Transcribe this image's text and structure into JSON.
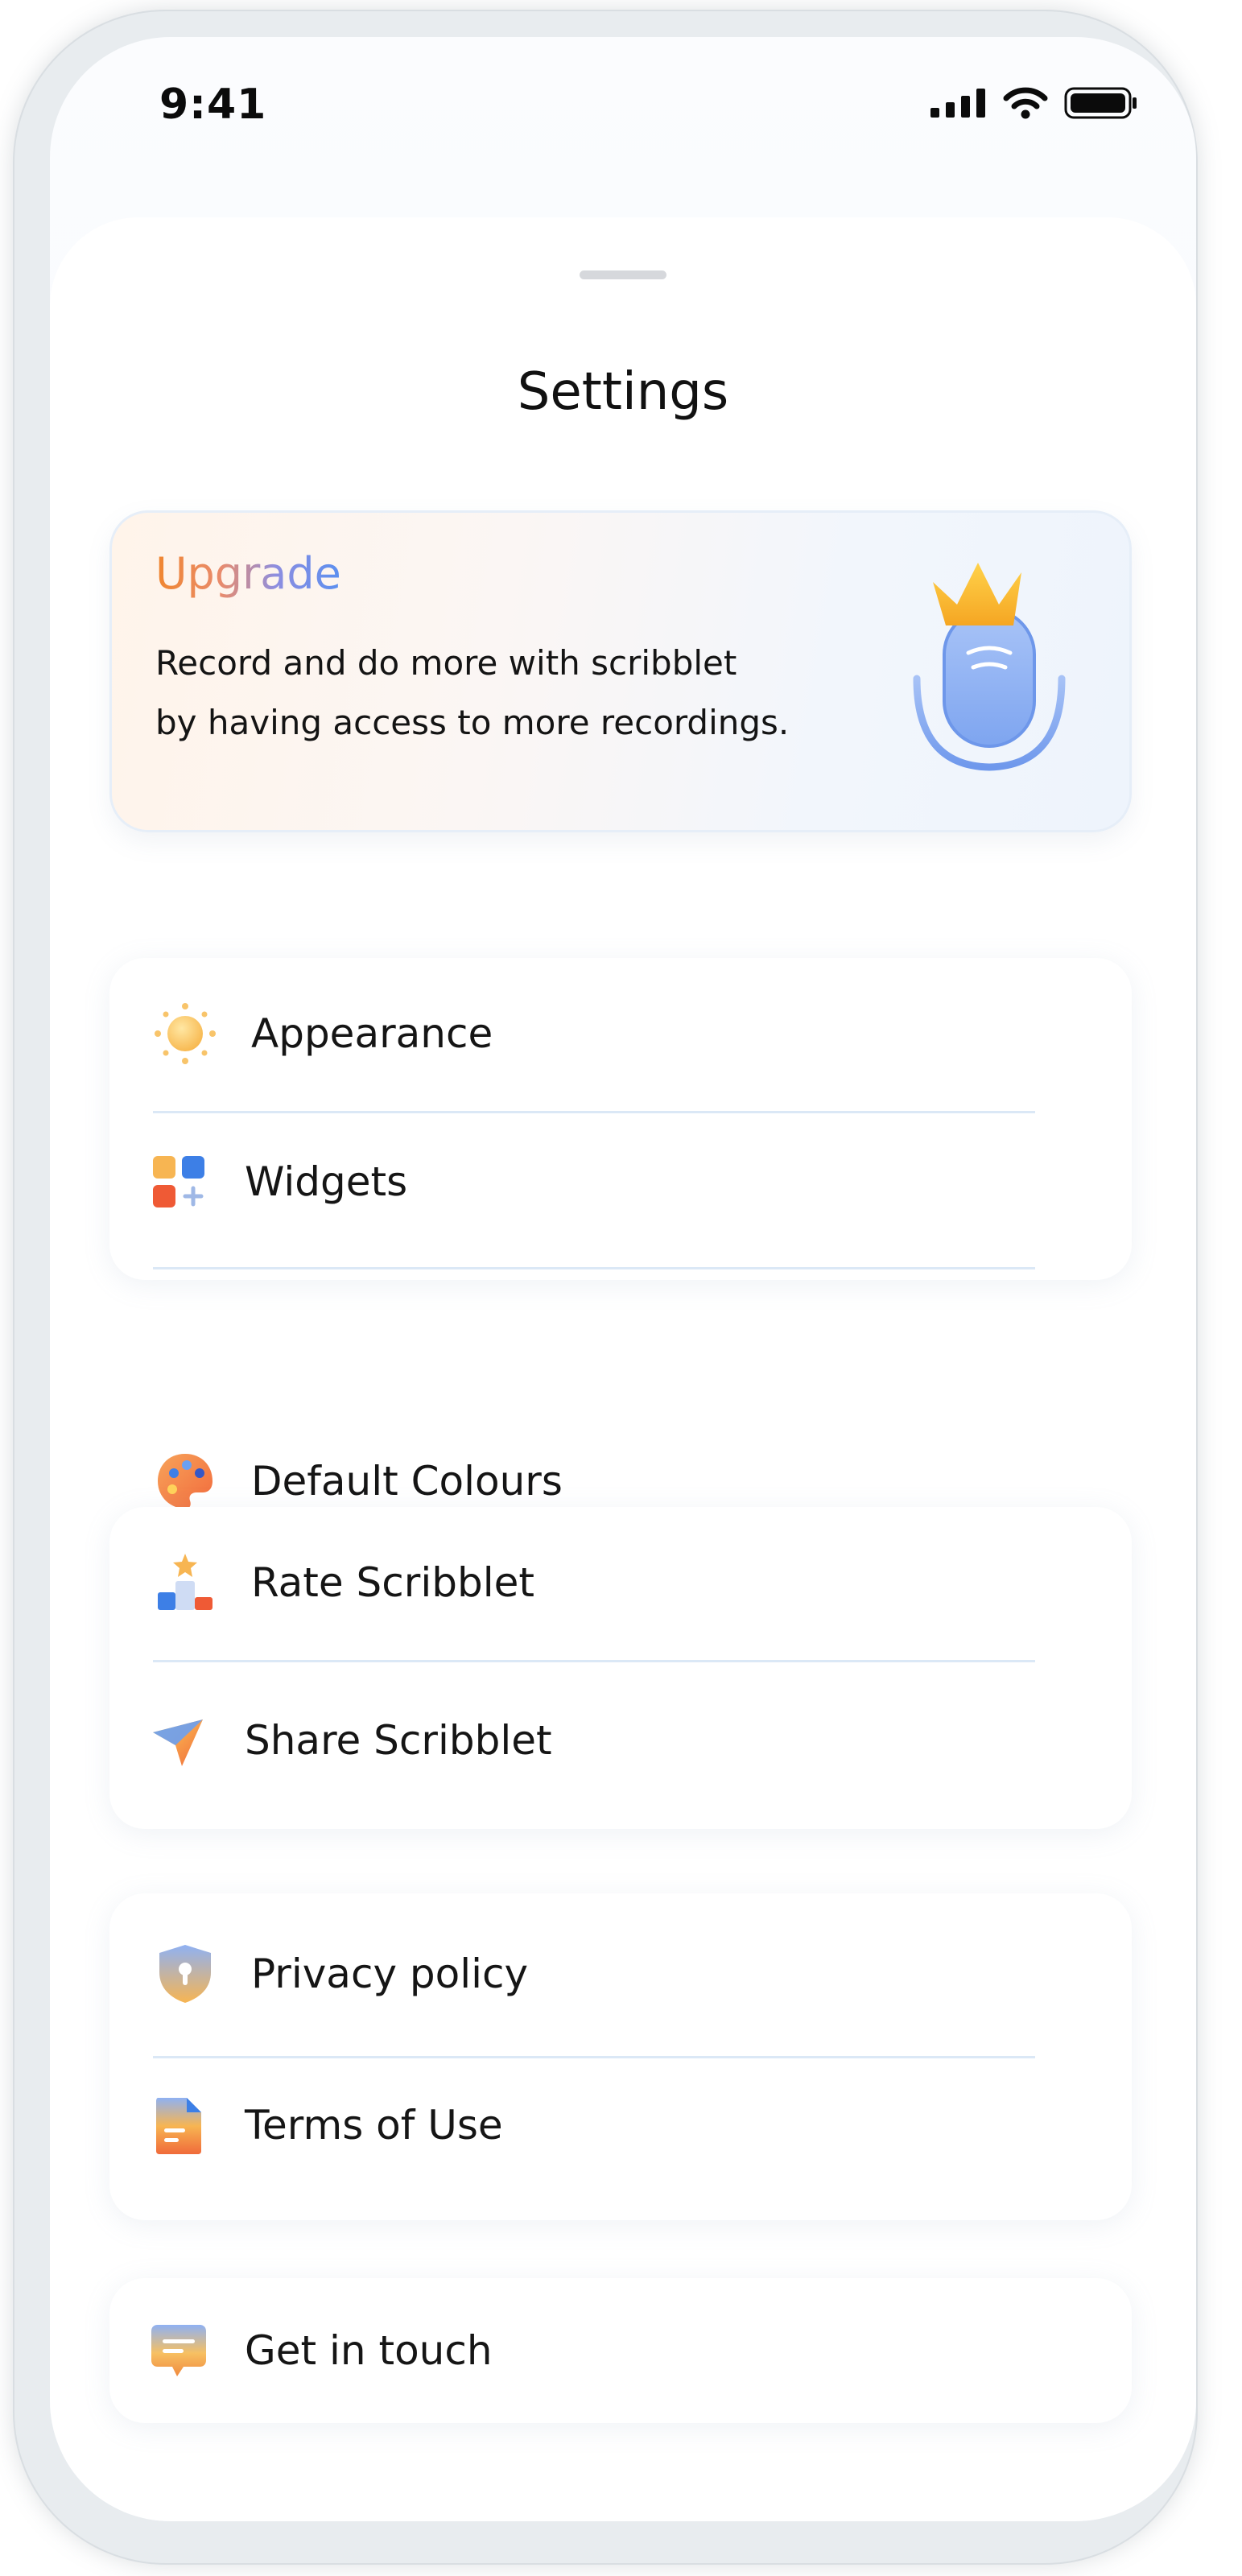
{
  "status_bar": {
    "time": "9:41",
    "icons": [
      "signal-icon",
      "wifi-icon",
      "battery-icon"
    ]
  },
  "sheet": {
    "title": "Settings"
  },
  "upgrade": {
    "title": "Upgrade",
    "line1": "Record and do more with scribblet",
    "line2": "by having access to more recordings.",
    "illustration": "crowned-mic-icon"
  },
  "groups": [
    {
      "items": [
        {
          "label": "Appearance",
          "icon": "sun-icon"
        },
        {
          "label": "Widgets",
          "icon": "widgets-icon"
        },
        {
          "label": "Default Colours",
          "icon": "palette-icon"
        }
      ]
    },
    {
      "items": [
        {
          "label": "Rate Scribblet",
          "icon": "podium-star-icon"
        },
        {
          "label": "Share Scribblet",
          "icon": "paper-plane-icon"
        }
      ]
    },
    {
      "items": [
        {
          "label": "Privacy policy",
          "icon": "shield-lock-icon"
        },
        {
          "label": "Terms of Use",
          "icon": "document-icon"
        }
      ]
    },
    {
      "items": [
        {
          "label": "Get in touch",
          "icon": "chat-bubble-icon"
        }
      ]
    }
  ],
  "colors": {
    "accent_blue": "#5b8ff0",
    "accent_orange": "#f0862f",
    "divider": "#dbe8f6",
    "text": "#151515"
  }
}
